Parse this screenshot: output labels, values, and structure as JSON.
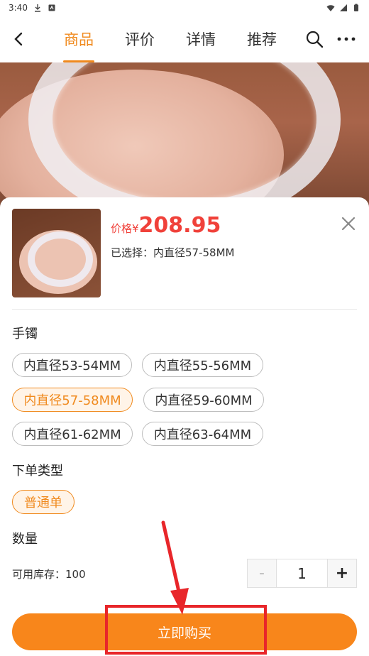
{
  "status_bar": {
    "time": "3:40"
  },
  "nav": {
    "tabs": [
      {
        "label": "商品",
        "active": true
      },
      {
        "label": "评价",
        "active": false
      },
      {
        "label": "详情",
        "active": false
      },
      {
        "label": "推荐",
        "active": false
      }
    ]
  },
  "sku_sheet": {
    "price_label": "价格¥",
    "price_value": "208.95",
    "selected_text": "已选择：内直径57-58MM",
    "bracelet_title": "手镯",
    "sizes": [
      {
        "label": "内直径53-54MM",
        "selected": false
      },
      {
        "label": "内直径55-56MM",
        "selected": false
      },
      {
        "label": "内直径57-58MM",
        "selected": true
      },
      {
        "label": "内直径59-60MM",
        "selected": false
      },
      {
        "label": "内直径61-62MM",
        "selected": false
      },
      {
        "label": "内直径63-64MM",
        "selected": false
      }
    ],
    "order_type_title": "下单类型",
    "order_types": [
      {
        "label": "普通单",
        "selected": true
      }
    ],
    "quantity_title": "数量",
    "stock_text": "可用库存：100",
    "minus": "-",
    "quantity": "1",
    "plus": "+",
    "buy_label": "立即购买"
  },
  "colors": {
    "accent": "#f08a1e",
    "price": "#f0413a",
    "button": "#f8861b",
    "annotation": "#e8262a"
  }
}
